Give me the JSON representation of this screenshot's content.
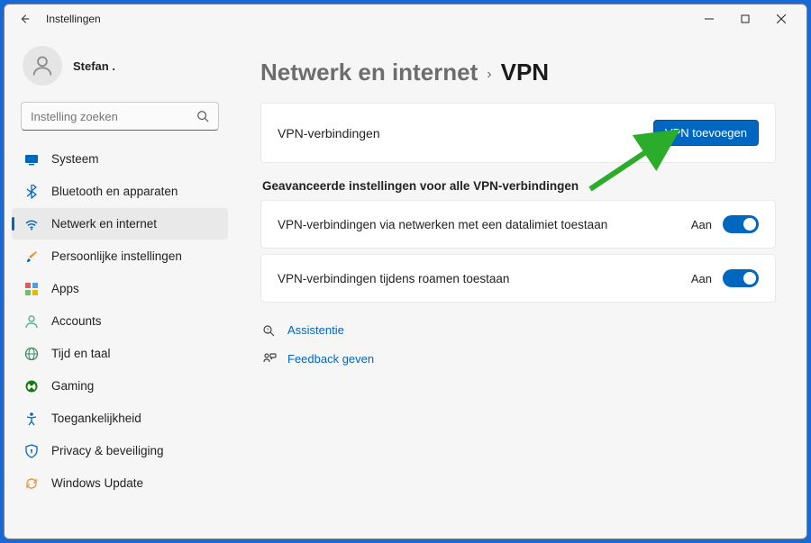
{
  "window": {
    "title": "Instellingen"
  },
  "user": {
    "name": "Stefan ."
  },
  "search": {
    "placeholder": "Instelling zoeken"
  },
  "sidebar": {
    "items": [
      {
        "label": "Systeem"
      },
      {
        "label": "Bluetooth en apparaten"
      },
      {
        "label": "Netwerk en internet",
        "selected": true
      },
      {
        "label": "Persoonlijke instellingen"
      },
      {
        "label": "Apps"
      },
      {
        "label": "Accounts"
      },
      {
        "label": "Tijd en taal"
      },
      {
        "label": "Gaming"
      },
      {
        "label": "Toegankelijkheid"
      },
      {
        "label": "Privacy & beveiliging"
      },
      {
        "label": "Windows Update"
      }
    ]
  },
  "breadcrumb": {
    "parent": "Netwerk en internet",
    "current": "VPN"
  },
  "vpn_section": {
    "connections_label": "VPN-verbindingen",
    "add_button": "VPN toevoegen"
  },
  "advanced": {
    "title": "Geavanceerde instellingen voor alle VPN-verbindingen",
    "settings": [
      {
        "label": "VPN-verbindingen via netwerken met een datalimiet toestaan",
        "state": "Aan"
      },
      {
        "label": "VPN-verbindingen tijdens roamen toestaan",
        "state": "Aan"
      }
    ]
  },
  "links": {
    "help": "Assistentie",
    "feedback": "Feedback geven"
  }
}
